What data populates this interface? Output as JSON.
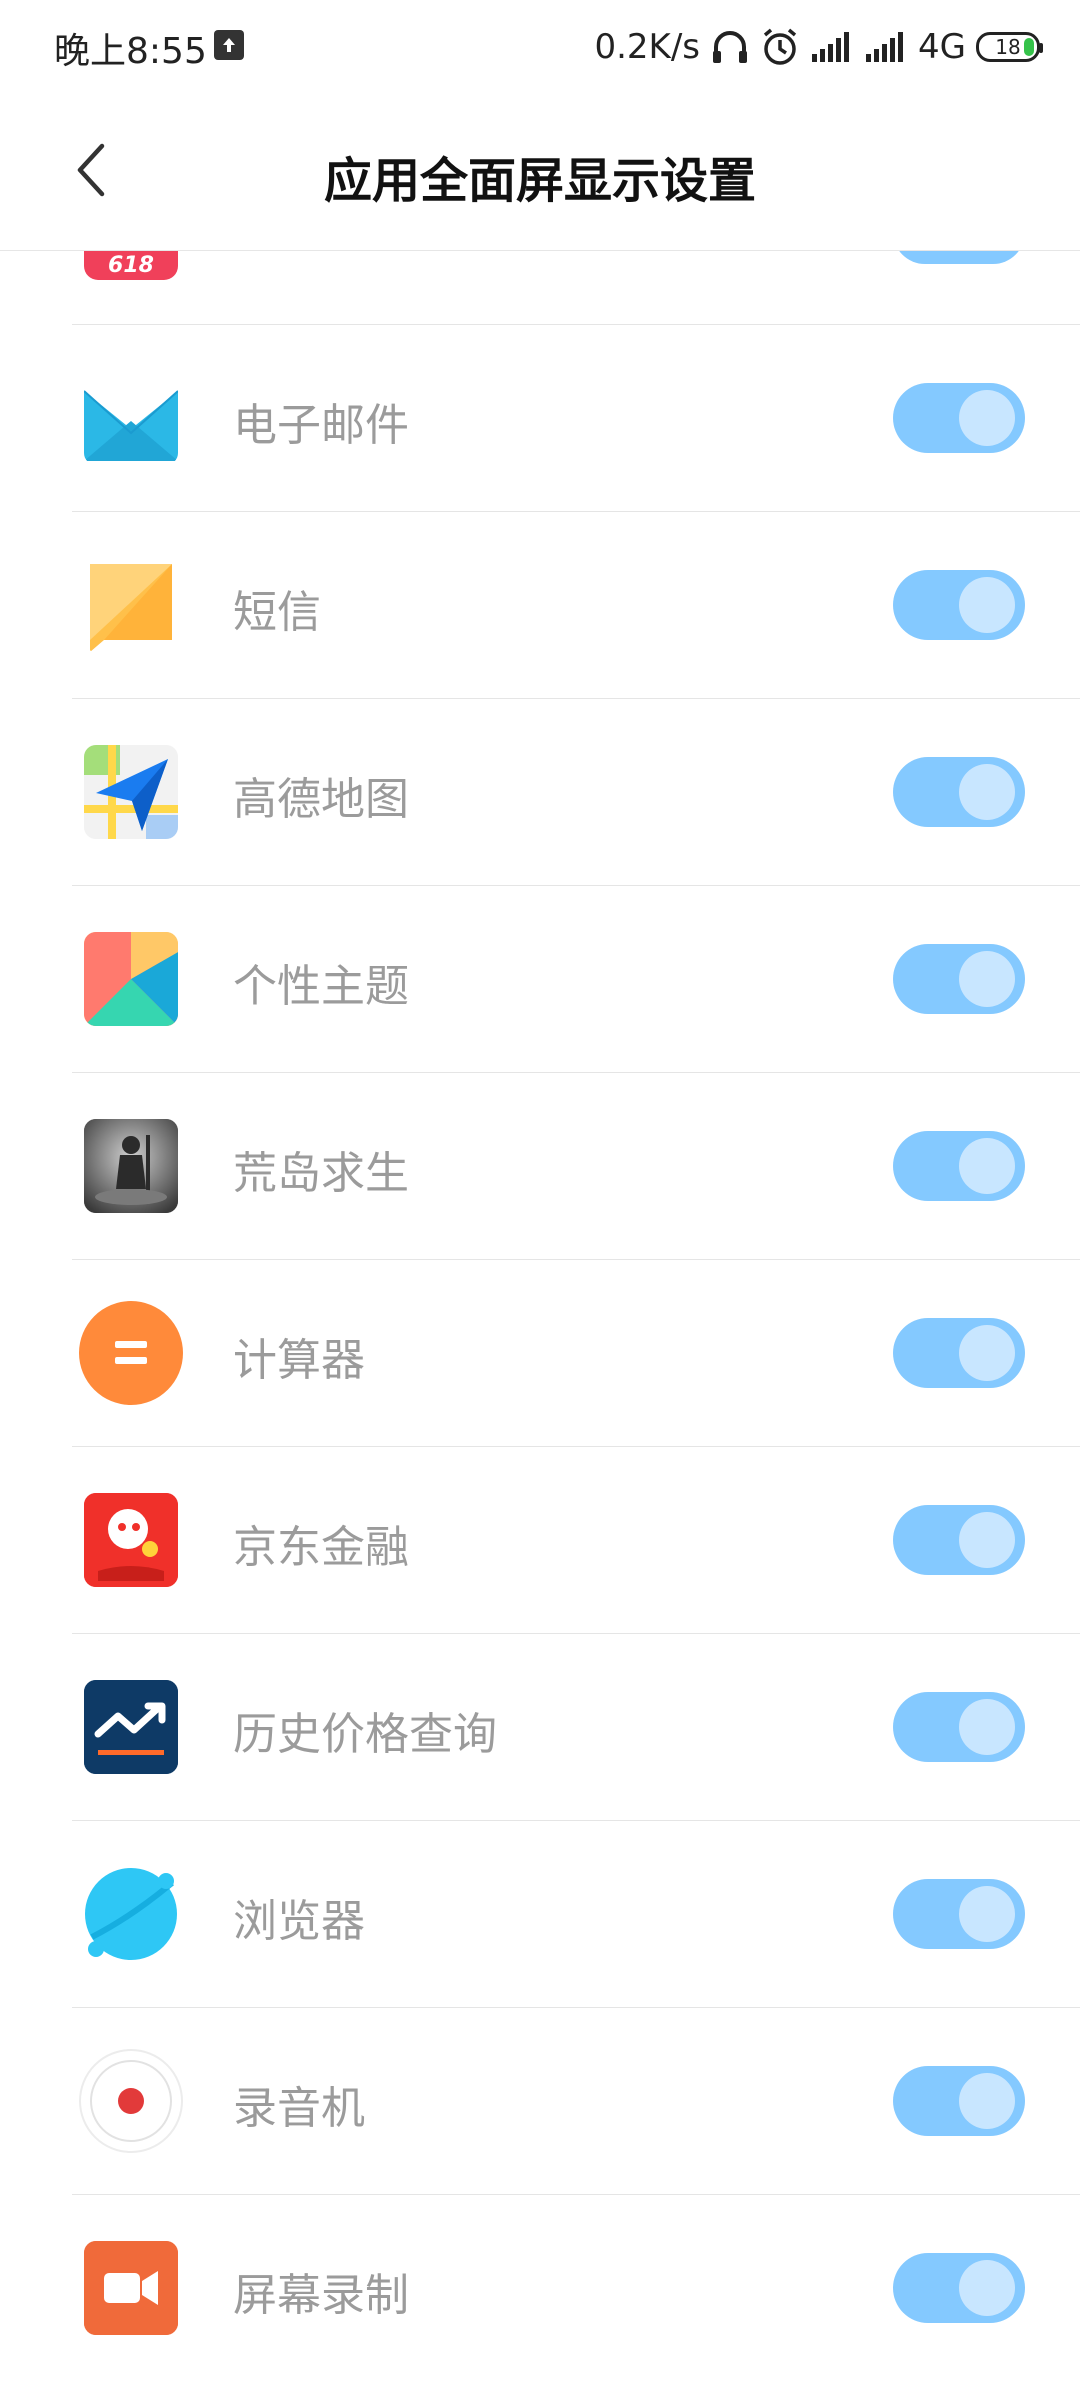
{
  "status": {
    "time": "晚上8:55",
    "speed": "0.2K/s",
    "network": "4G",
    "battery": "18"
  },
  "header": {
    "title": "应用全面屏显示设置"
  },
  "apps": [
    {
      "name": "电子邮件"
    },
    {
      "name": "短信"
    },
    {
      "name": "高德地图"
    },
    {
      "name": "个性主题"
    },
    {
      "name": "荒岛求生"
    },
    {
      "name": "计算器"
    },
    {
      "name": "京东金融"
    },
    {
      "name": "历史价格查询"
    },
    {
      "name": "浏览器"
    },
    {
      "name": "录音机"
    },
    {
      "name": "屏幕录制"
    }
  ],
  "partial_app": {
    "badge": "618"
  },
  "colors": {
    "toggle_on": "#84c9ff",
    "label": "#9b9b9b"
  }
}
